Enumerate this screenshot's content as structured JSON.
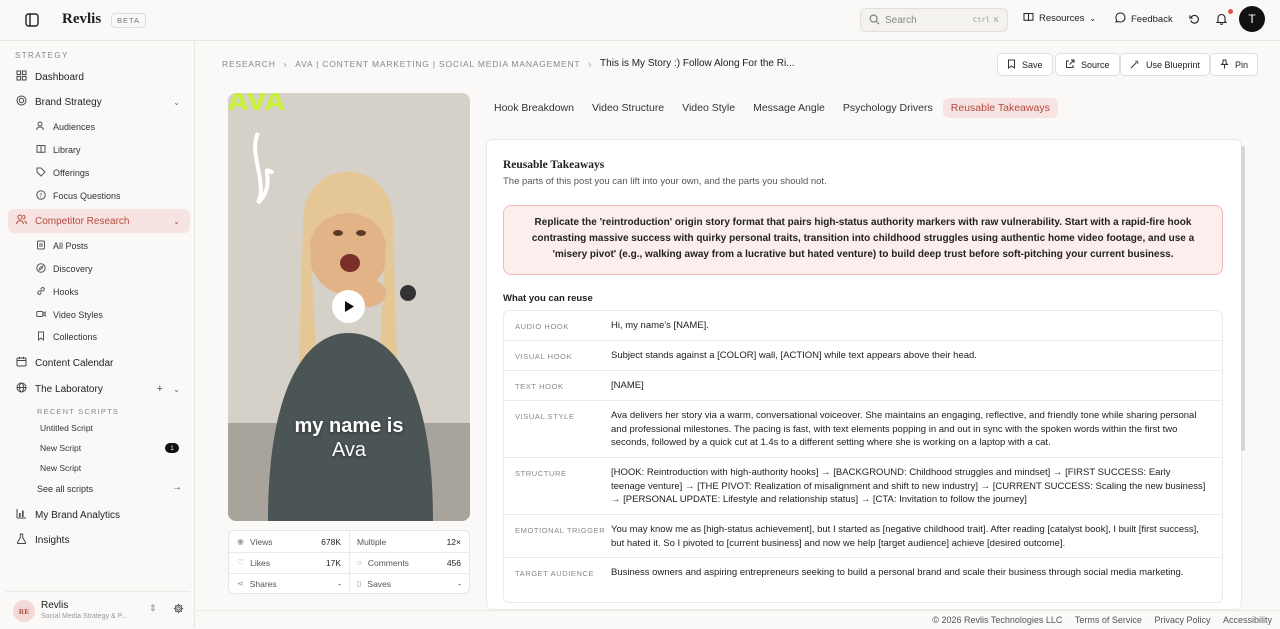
{
  "topbar": {
    "brand": "Revlis",
    "beta": "BETA",
    "search_placeholder": "Search",
    "search_shortcut": "Ctrl K",
    "resources": "Resources",
    "feedback": "Feedback",
    "avatar_initial": "T"
  },
  "sidebar": {
    "section": "STRATEGY",
    "dashboard": "Dashboard",
    "brand_strategy": "Brand Strategy",
    "brand_items": [
      "Audiences",
      "Library",
      "Offerings",
      "Focus Questions"
    ],
    "competitor_research": "Competitor Research",
    "competitor_items": [
      "All Posts",
      "Discovery",
      "Hooks",
      "Video Styles",
      "Collections"
    ],
    "content_calendar": "Content Calendar",
    "laboratory": "The Laboratory",
    "recent_label": "RECENT SCRIPTS",
    "recent": [
      "Untitled Script",
      "New Script",
      "New Script"
    ],
    "recent_badge": "1",
    "see_all": "See all scripts",
    "analytics": "My Brand Analytics",
    "insights": "Insights",
    "workspace": {
      "initials": "RE",
      "name": "Revlis",
      "sub": "Social Media Strategy & P..."
    }
  },
  "breadcrumb": {
    "research": "RESEARCH",
    "account": "AVA | CONTENT MARKETING | SOCIAL MEDIA MANAGEMENT",
    "current": "This is My Story :) Follow Along For the Ri..."
  },
  "actions": {
    "save": "Save",
    "source": "Source",
    "blueprint": "Use Blueprint",
    "pin": "Pin"
  },
  "video": {
    "caption_top": "my name is",
    "caption_bottom": "Ava",
    "corner_text": "AVA"
  },
  "stats": {
    "views_label": "Views",
    "views": "678K",
    "multiple_label": "Multiple",
    "multiple": "12×",
    "likes_label": "Likes",
    "likes": "17K",
    "comments_label": "Comments",
    "comments": "456",
    "shares_label": "Shares",
    "shares": "-",
    "saves_label": "Saves",
    "saves": "-"
  },
  "tabs": [
    "Hook Breakdown",
    "Video Structure",
    "Video Style",
    "Message Angle",
    "Psychology Drivers",
    "Reusable Takeaways"
  ],
  "panel": {
    "title": "Reusable Takeaways",
    "subtitle": "The parts of this post you can lift into your own, and the parts you should not.",
    "callout": "Replicate the 'reintroduction' origin story format that pairs high-status authority markers with raw vulnerability. Start with a rapid-fire hook contrasting massive success with quirky personal traits, transition into childhood struggles using authentic home video footage, and use a 'misery pivot' (e.g., walking away from a lucrative but hated venture) to build deep trust before soft-pitching your current business.",
    "reuse_heading": "What you can reuse",
    "rows": [
      {
        "key": "AUDIO HOOK",
        "value": "Hi, my name's [NAME]."
      },
      {
        "key": "VISUAL HOOK",
        "value": "Subject stands against a [COLOR] wall, [ACTION] while text appears above their head."
      },
      {
        "key": "TEXT HOOK",
        "value": "[NAME]"
      },
      {
        "key": "VISUAL STYLE",
        "value": "Ava delivers her story via a warm, conversational voiceover. She maintains an engaging, reflective, and friendly tone while sharing personal and professional milestones. The pacing is fast, with text elements popping in and out in sync with the spoken words within the first two seconds, followed by a quick cut at 1.4s to a different setting where she is working on a laptop with a cat."
      },
      {
        "key": "STRUCTURE",
        "value": "[HOOK: Reintroduction with high-authority hooks] → [BACKGROUND: Childhood struggles and mindset] → [FIRST SUCCESS: Early teenage venture] → [THE PIVOT: Realization of misalignment and shift to new industry] → [CURRENT SUCCESS: Scaling the new business] → [PERSONAL UPDATE: Lifestyle and relationship status] → [CTA: Invitation to follow the journey]"
      },
      {
        "key": "EMOTIONAL TRIGGER",
        "value": "You may know me as [high-status achievement], but I started as [negative childhood trait]. After reading [catalyst book], I built [first success], but hated it. So I pivoted to [current business] and now we help [target audience] achieve [desired outcome]."
      },
      {
        "key": "TARGET AUDIENCE",
        "value": "Business owners and aspiring entrepreneurs seeking to build a personal brand and scale their business through social media marketing."
      }
    ]
  },
  "footer": {
    "copyright": "© 2026 Revlis Technologies LLC",
    "terms": "Terms of Service",
    "privacy": "Privacy Policy",
    "accessibility": "Accessibility"
  }
}
